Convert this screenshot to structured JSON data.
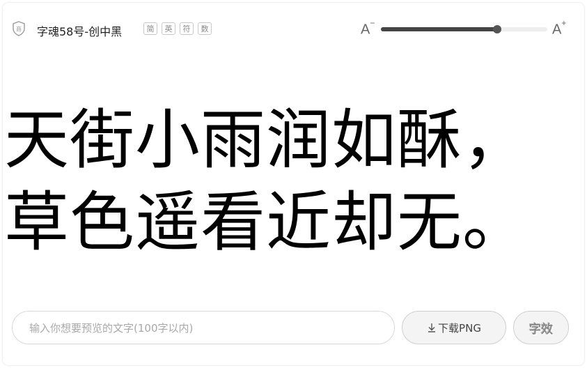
{
  "header": {
    "license_icon": "shield-icon",
    "font_name": "字魂58号-创中黑",
    "tags": [
      "简",
      "英",
      "符",
      "数"
    ]
  },
  "size_control": {
    "decrease_label": "A",
    "decrease_sup": "−",
    "increase_label": "A",
    "increase_sup": "+",
    "slider_level": 0.7
  },
  "preview": {
    "lines": [
      "天街小雨润如酥，",
      "草色遥看近却无。"
    ]
  },
  "input": {
    "value": "",
    "placeholder": "输入你想要预览的文字(100字以内)"
  },
  "buttons": {
    "download_icon": "download-icon",
    "download_label": "下载PNG",
    "effect_label": "字效"
  },
  "colors": {
    "slider_fill": "#444444",
    "slider_track": "#eeeeee",
    "preview_text": "#000000",
    "border": "#d8d8d8"
  }
}
